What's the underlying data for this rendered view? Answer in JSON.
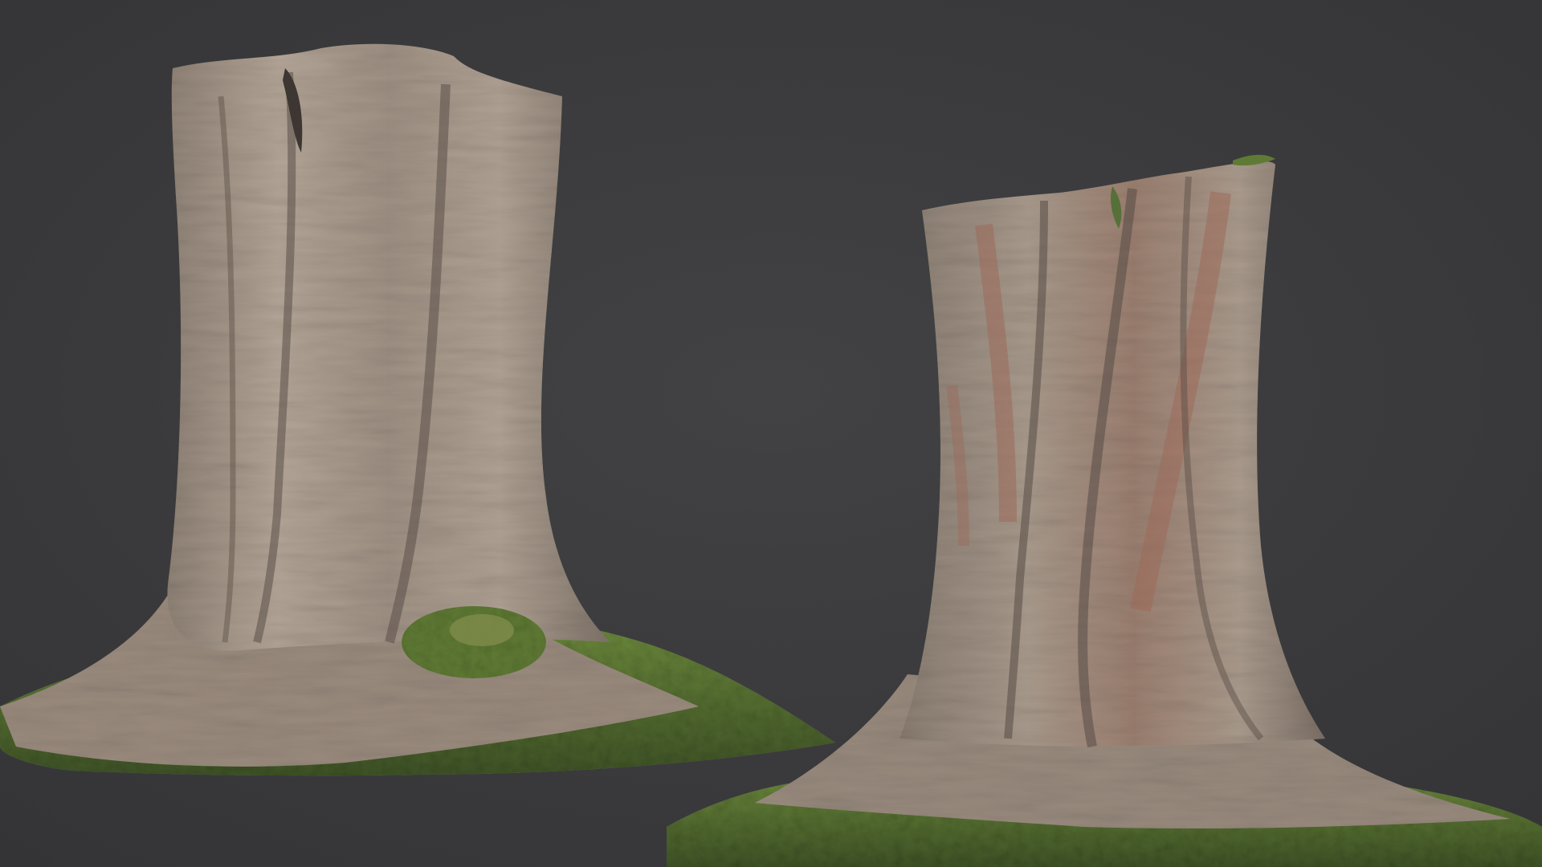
{
  "scene": {
    "background_color": "#3a3a3c",
    "bark_color": "#a89a8c",
    "bark_shadow_color": "#5d524b",
    "bark_reddish_color": "#9c6a5a",
    "moss_color": "#5f7a34",
    "moss_dark_color": "#3e5226"
  },
  "objects": [
    {
      "name": "tree-stump-left",
      "description_icon": "tree-stump-icon"
    },
    {
      "name": "tree-stump-right",
      "description_icon": "tree-stump-icon"
    }
  ]
}
